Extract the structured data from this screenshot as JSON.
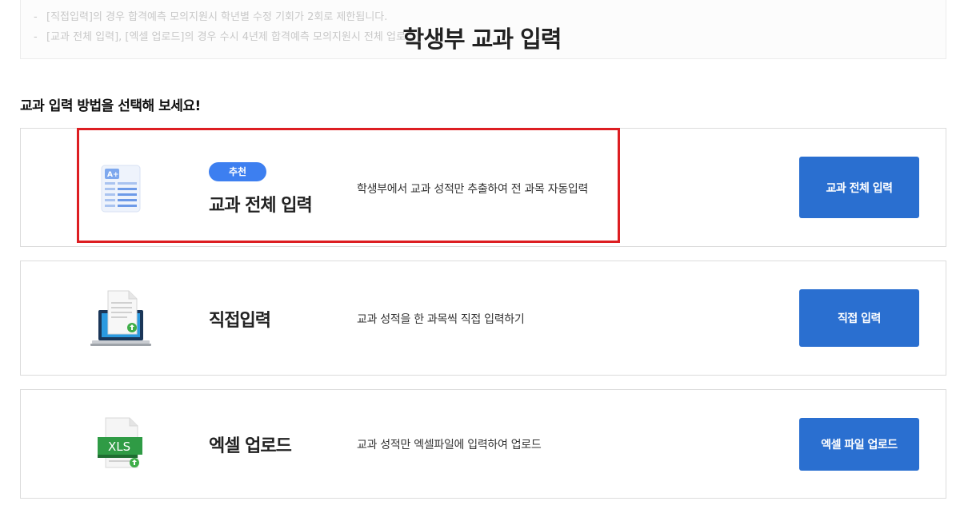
{
  "header": {
    "title": "학생부 교과 입력"
  },
  "notice": {
    "lines": [
      "[직접입력]의 경우 합격예측 모의지원시 학년별 수정 기회가 2회로 제한됩니다.",
      "[교과 전체 입력], [엑셀 업로드]의 경우 수시 4년제 합격예측 모의지원시 전체 업로"
    ]
  },
  "section": {
    "heading": "교과 입력 방법을 선택해 보세요!"
  },
  "cards": [
    {
      "badge": "추천",
      "title": "교과 전체 입력",
      "description": "학생부에서 교과 성적만 추출하여 전 과목 자동입력",
      "button": "교과 전체 입력",
      "icon": "grade-sheet-icon"
    },
    {
      "title": "직접입력",
      "description": "교과 성적을 한 과목씩 직접 입력하기",
      "button": "직접 입력",
      "icon": "laptop-document-icon"
    },
    {
      "title": "엑셀 업로드",
      "description": "교과 성적만 엑셀파일에 입력하여 업로드",
      "button": "엑셀 파일 업로드",
      "icon": "xls-file-icon",
      "icon_text": "XLS"
    }
  ],
  "colors": {
    "accent": "#2a6fd0",
    "badge": "#3d7ff0",
    "highlight": "#dd1e22"
  }
}
